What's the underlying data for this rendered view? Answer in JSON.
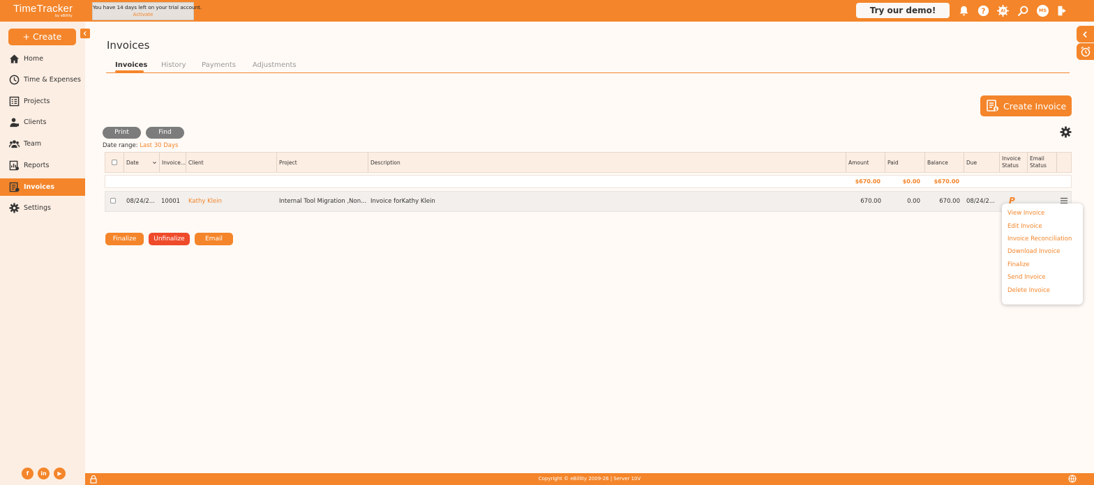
{
  "app": {
    "logo": "TimeTracker",
    "logo_sub": "by eBillity",
    "trial_text": "You have 14 days left on your trial account.",
    "trial_link": "Activate",
    "demo_label": "Try our demo!",
    "avatar_initials": "MS",
    "accent_color": "#f4852a"
  },
  "sidebar": {
    "create_label": "+ Create",
    "items": [
      {
        "label": "Home",
        "icon": "home-icon"
      },
      {
        "label": "Time & Expenses",
        "icon": "clock-icon"
      },
      {
        "label": "Projects",
        "icon": "projects-icon"
      },
      {
        "label": "Clients",
        "icon": "clients-icon"
      },
      {
        "label": "Team",
        "icon": "team-icon"
      },
      {
        "label": "Reports",
        "icon": "reports-icon"
      },
      {
        "label": "Invoices",
        "icon": "invoices-icon",
        "active": true
      },
      {
        "label": "Settings",
        "icon": "settings-icon"
      }
    ],
    "social": [
      "f",
      "in",
      "▶"
    ]
  },
  "page": {
    "title": "Invoices",
    "tabs": [
      "Invoices",
      "History",
      "Payments",
      "Adjustments"
    ],
    "active_tab": "Invoices",
    "create_invoice_label": "Create Invoice",
    "print_label": "Print",
    "find_label": "Find",
    "date_range_label": "Date range:",
    "date_range_value": "Last 30 Days"
  },
  "grid": {
    "columns": [
      "Date",
      "Invoice...",
      "Client",
      "Project",
      "Description",
      "Amount",
      "Paid",
      "Balance",
      "Due",
      "Invoice Status",
      "Email Status"
    ],
    "totals": {
      "amount": "$670.00",
      "paid": "$0.00",
      "balance": "$670.00"
    },
    "rows": [
      {
        "date": "08/24/2...",
        "invoice": "10001",
        "client": "Kathy Klein",
        "project": "Internal Tool Migration ,Non...",
        "description": "Invoice forKathy Klein",
        "amount": "670.00",
        "paid": "0.00",
        "balance": "670.00",
        "due": "08/24/2...",
        "status": "P"
      }
    ]
  },
  "actions": {
    "finalize": "Finalize",
    "unfinalize": "Unfinalize",
    "email": "Email"
  },
  "row_menu": {
    "items": [
      "View Invoice",
      "Edit Invoice",
      "Invoice Reconciliation",
      "Download Invoice",
      "Finalize",
      "Send Invoice",
      "Delete Invoice"
    ]
  },
  "footer": {
    "text": "Copyright © eBillity 2009-26  |  Server 10V"
  }
}
